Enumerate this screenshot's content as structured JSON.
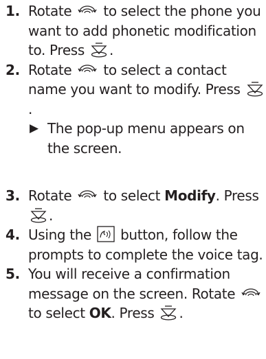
{
  "steps": [
    {
      "num": "1.",
      "parts": [
        "Rotate",
        "to select the phone you want to add phonetic modification to. Press",
        "."
      ]
    },
    {
      "num": "2.",
      "parts": [
        "Rotate",
        "to select a contact name you want to modify. Press",
        "."
      ],
      "result": "The pop-up menu appears on the screen."
    },
    {
      "num": "3.",
      "parts": [
        "Rotate",
        "to select",
        "Modify",
        ". Press",
        "."
      ]
    },
    {
      "num": "4.",
      "parts": [
        "Using the",
        "button, follow the prompts to complete the voice tag."
      ]
    },
    {
      "num": "5.",
      "parts": [
        "You will receive a confirmation message on the screen. Rotate",
        "to select",
        "OK",
        ". Press",
        "."
      ]
    }
  ],
  "icons": {
    "interface_dial": "interface-dial-icon",
    "enter_button": "press-enter-icon",
    "talk_button": "talk-button-icon",
    "result_marker": "triangle-right-icon"
  },
  "colors": {
    "text": "#231f20"
  }
}
